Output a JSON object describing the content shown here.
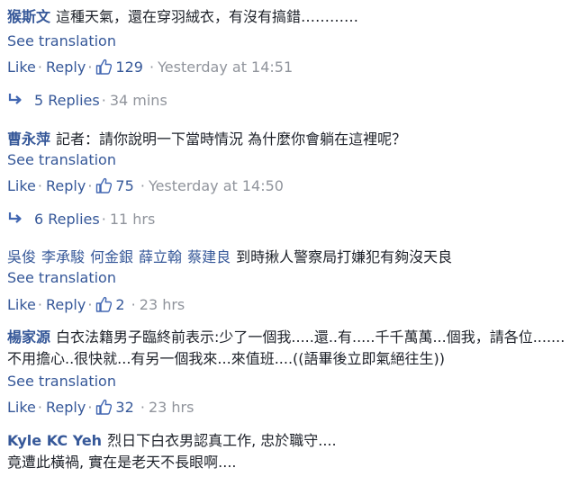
{
  "ui": {
    "see_translation": "See translation",
    "like": "Like",
    "reply": "Reply"
  },
  "comments": [
    {
      "author": "猴斯文",
      "text": "這種天氣，還在穿羽絨衣，有沒有搞錯…………",
      "likes": "129",
      "time": "Yesterday at 14:51",
      "replies_label": "5 Replies",
      "replies_time": "34 mins"
    },
    {
      "author": "曹永萍",
      "text": "記者：請你說明一下當時情況 為什麼你會躺在這裡呢？",
      "likes": "75",
      "time": "Yesterday at 14:50",
      "replies_label": "6 Replies",
      "replies_time": "11 hrs"
    },
    {
      "author": "吳俊",
      "tagged": [
        "李承駿",
        "何金銀",
        "薛立翰",
        "蔡建良"
      ],
      "text": "到時揪人警察局打嫌犯有夠沒天良",
      "likes": "2",
      "time": "23 hrs"
    },
    {
      "author": "楊家源",
      "text": "白衣法籍男子臨終前表示:少了一個我.....還..有.....千千萬萬...個我，請各位.......不用擔心..很快就...有另一個我來...來值班....((語畢後立即氣絕往生))",
      "likes": "32",
      "time": "23 hrs"
    },
    {
      "author": "Kyle KC Yeh",
      "text": "烈日下白衣男認真工作, 忠於職守....",
      "text2": "竟遭此橫禍, 實在是老天不長眼啊...."
    }
  ]
}
